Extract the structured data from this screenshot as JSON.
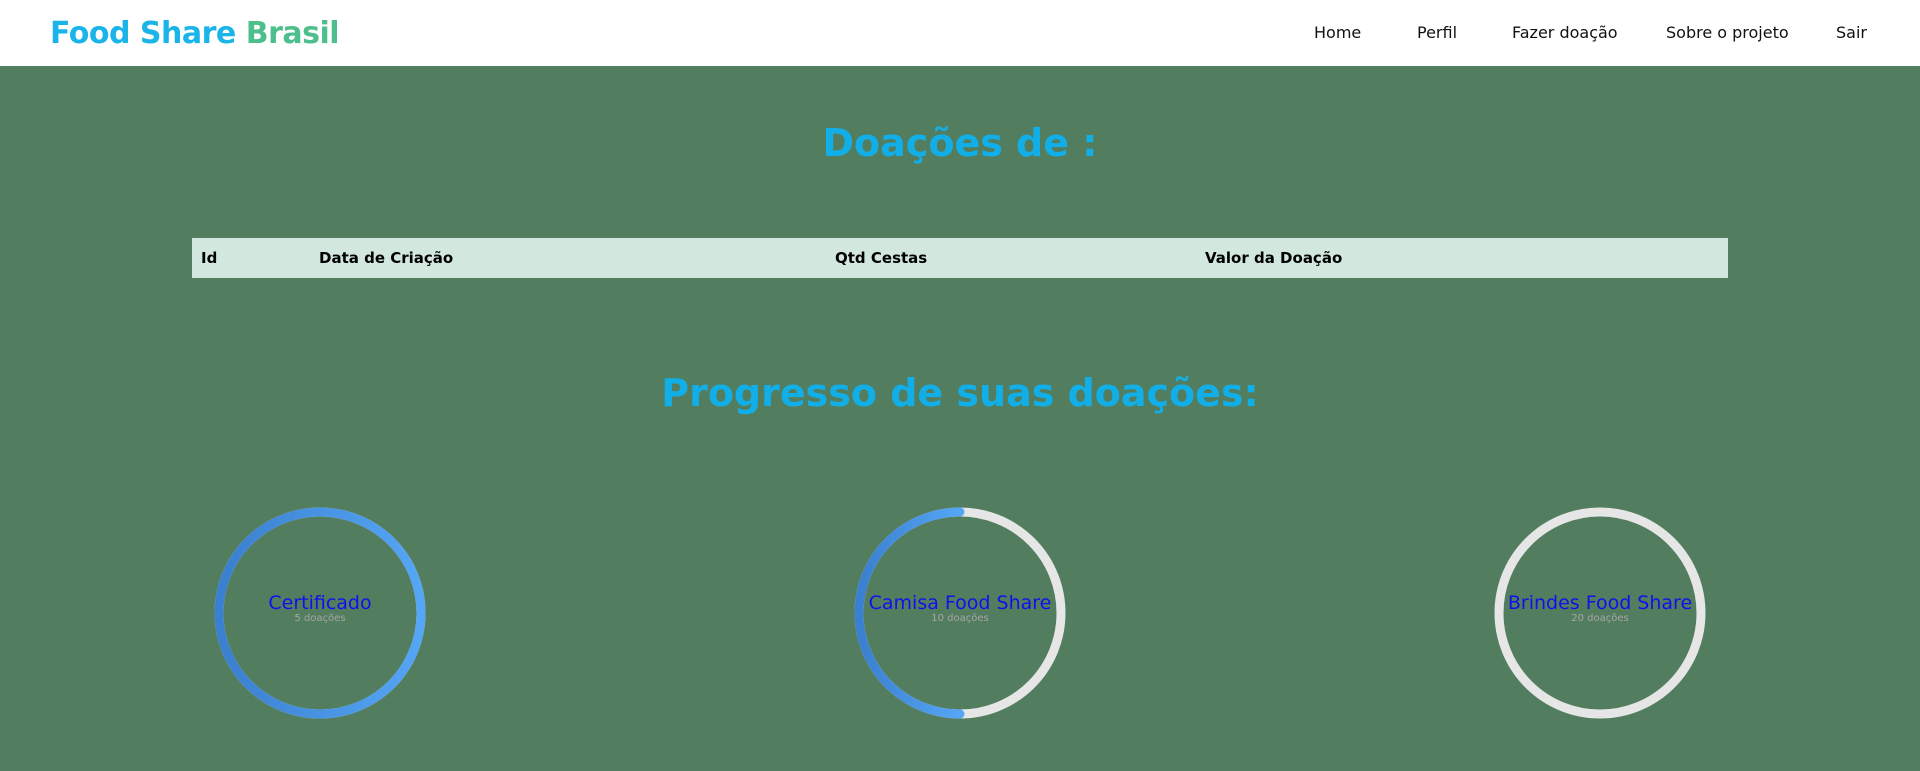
{
  "navbar": {
    "brand_part1": "Food Share",
    "brand_part2": "Brasil",
    "links": [
      {
        "label": "Home"
      },
      {
        "label": "Perfil"
      },
      {
        "label": "Fazer doação"
      },
      {
        "label": "Sobre o projeto"
      },
      {
        "label": "Sair"
      }
    ]
  },
  "donations": {
    "title": "Doações de :",
    "columns": [
      "Id",
      "Data de Criação",
      "Qtd Cestas",
      "Valor da Doação"
    ],
    "rows": []
  },
  "progress": {
    "title": "Progresso de suas doações:",
    "goals": [
      {
        "label": "Certificado",
        "sub": "5 doações",
        "progress": 1.0
      },
      {
        "label": "Camisa Food Share",
        "sub": "10 doações",
        "progress": 0.5
      },
      {
        "label": "Brindes Food Share",
        "sub": "20 doações",
        "progress": 0.0
      }
    ]
  },
  "colors": {
    "background": "#537d5f",
    "accent": "#12aee8",
    "brand_green": "#4cbf8c",
    "ring_track": "#e6e6e6",
    "ring_fill_start": "#3b7fcf",
    "ring_fill_end": "#55a6f5"
  }
}
